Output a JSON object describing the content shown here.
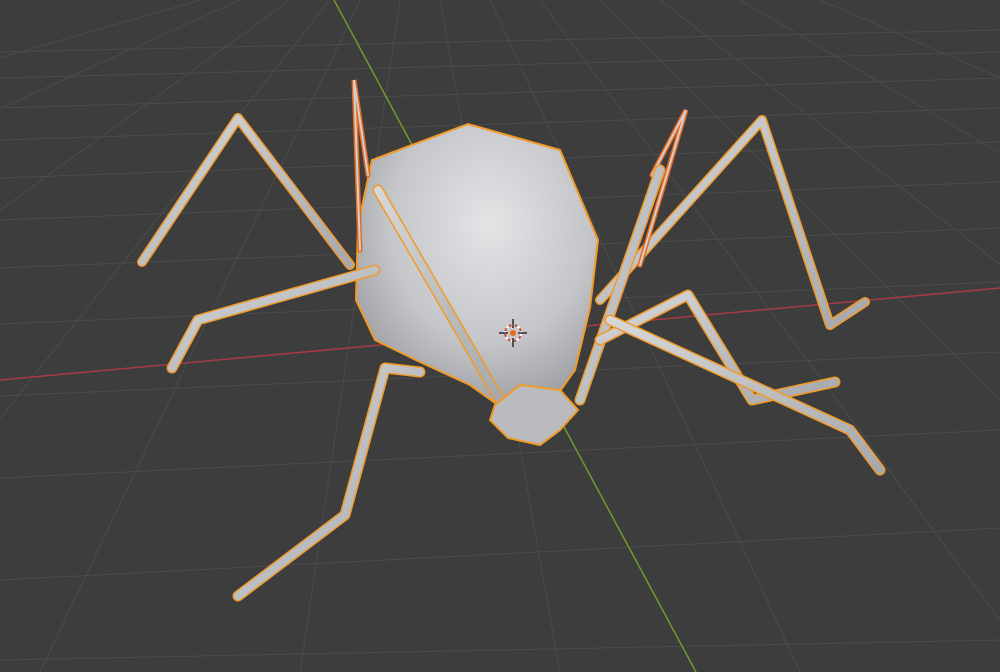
{
  "viewport": {
    "background": "#3d3d3d",
    "grid_color": "#4a4a4a",
    "x_axis_color": "#a83a46",
    "y_axis_color": "#6f9a2a"
  },
  "object": {
    "type": "mesh",
    "selected": true,
    "outline_color": "#f29a27",
    "active_outline_color": "#e86a1f",
    "mesh_color": "#c9cacc"
  },
  "gizmo": {
    "icon": "3d-cursor-icon"
  }
}
